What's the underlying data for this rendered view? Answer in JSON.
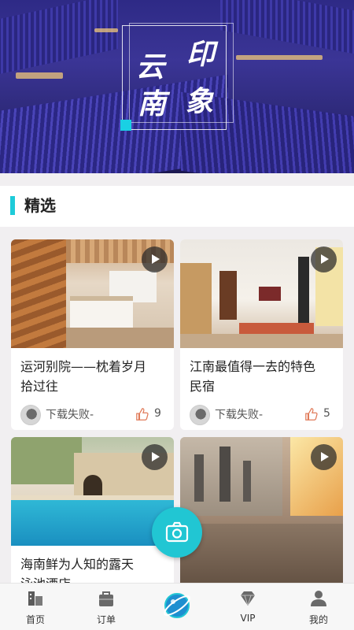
{
  "banner": {
    "chars": [
      "云",
      "南",
      "印",
      "象"
    ]
  },
  "section": {
    "title": "精选"
  },
  "cards": [
    {
      "title_line1": "运河别院——枕着岁月",
      "title_line2": "拾过往",
      "author": "下载失败-",
      "likes": "9"
    },
    {
      "title_line1": "江南最值得一去的特色",
      "title_line2": "民宿",
      "author": "下载失败-",
      "likes": "5"
    },
    {
      "title_line1": "海南鲜为人知的露天",
      "title_line2": "泳池酒店",
      "author": "",
      "likes": ""
    },
    {
      "title_line1": "",
      "title_line2": "",
      "author": "",
      "likes": ""
    }
  ],
  "nav": {
    "items": [
      {
        "label": "首页",
        "icon": "home-icon"
      },
      {
        "label": "订单",
        "icon": "bag-icon"
      },
      {
        "label": "",
        "icon": "planet-icon"
      },
      {
        "label": "VIP",
        "icon": "diamond-icon"
      },
      {
        "label": "我的",
        "icon": "user-icon"
      }
    ]
  },
  "colors": {
    "accent": "#1ecbd9",
    "banner": "#2e2a86"
  }
}
